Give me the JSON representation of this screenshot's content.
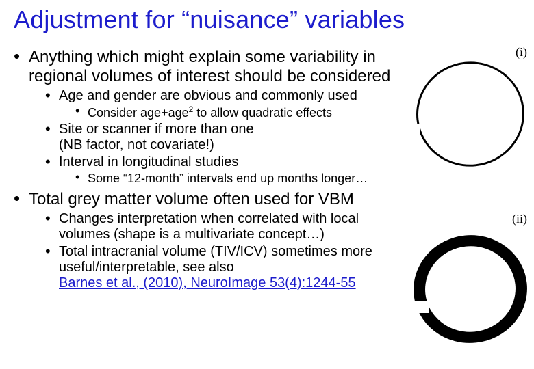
{
  "title": "Adjustment for “nuisance” variables",
  "b1": {
    "text": "Anything which might explain some variability in regional volumes of interest should be considered",
    "sub": {
      "s1": "Age and gender are obvious and commonly used",
      "s1a_pre": "Consider age+age",
      "s1a_sup": "2",
      "s1a_post": " to allow quadratic effects",
      "s2": "Site or scanner if more than one",
      "s2_note": "(NB factor, not covariate!)",
      "s3": "Interval in longitudinal studies",
      "s3a": "Some “12-month” intervals end up months longer…"
    }
  },
  "b2": {
    "text": "Total grey matter volume often used for VBM",
    "sub": {
      "s1": "Changes interpretation when correlated with local volumes (shape is a multivariate concept…)",
      "s2_pre": "Total intracranial volume (TIV/ICV) sometimes more useful/interpretable, see also",
      "s2_link": "Barnes et al., (2010), NeuroImage 53(4):1244-55"
    }
  },
  "figs": {
    "label_i": "(i)",
    "label_ii": "(ii)"
  }
}
